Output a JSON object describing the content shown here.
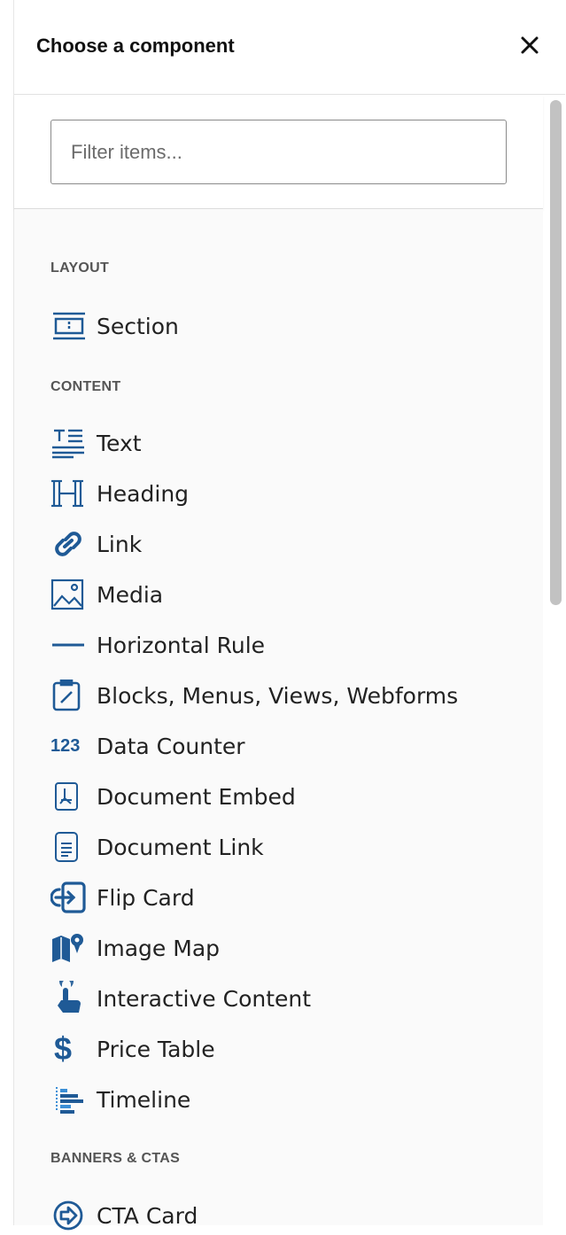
{
  "header": {
    "title": "Choose a component",
    "close_glyph": "✕"
  },
  "search": {
    "placeholder": "Filter items..."
  },
  "colors": {
    "icon": "#1f5a96",
    "icon_light": "#3c8fd6",
    "text": "#222222",
    "group": "#555555"
  },
  "groups": [
    {
      "label": "LAYOUT",
      "items": [
        {
          "label": "Section",
          "icon": "section-icon"
        }
      ]
    },
    {
      "label": "CONTENT",
      "items": [
        {
          "label": "Text",
          "icon": "text-icon"
        },
        {
          "label": "Heading",
          "icon": "heading-icon"
        },
        {
          "label": "Link",
          "icon": "link-icon"
        },
        {
          "label": "Media",
          "icon": "media-icon"
        },
        {
          "label": "Horizontal Rule",
          "icon": "horizontal-rule-icon"
        },
        {
          "label": "Blocks, Menus, Views, Webforms",
          "icon": "blocks-icon"
        },
        {
          "label": "Data Counter",
          "icon": "data-counter-icon",
          "icon_text": "123"
        },
        {
          "label": "Document Embed",
          "icon": "document-embed-icon"
        },
        {
          "label": "Document Link",
          "icon": "document-link-icon"
        },
        {
          "label": "Flip Card",
          "icon": "flip-card-icon"
        },
        {
          "label": "Image Map",
          "icon": "image-map-icon"
        },
        {
          "label": "Interactive Content",
          "icon": "interactive-content-icon"
        },
        {
          "label": "Price Table",
          "icon": "price-table-icon",
          "icon_text": "$"
        },
        {
          "label": "Timeline",
          "icon": "timeline-icon"
        }
      ]
    },
    {
      "label": "BANNERS & CTAS",
      "items": [
        {
          "label": "CTA Card",
          "icon": "cta-card-icon"
        }
      ]
    }
  ]
}
